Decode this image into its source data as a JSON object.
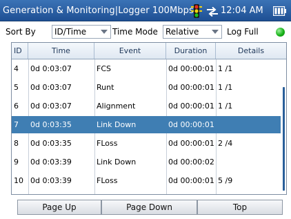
{
  "titlebar": {
    "title": "Generation  &  Monitoring|Logger 100Mbps",
    "time": "12:04 AM",
    "icons": [
      "traffic-light-icon",
      "transfer-arrows-icon",
      "battery-icon"
    ]
  },
  "controls": {
    "sort_by_label": "Sort By",
    "sort_by_value": "ID/Time",
    "time_mode_label": "Time Mode",
    "time_mode_value": "Relative",
    "log_full_label": "Log Full",
    "log_full_status_color": "#19b319"
  },
  "table": {
    "columns": [
      "ID",
      "Time",
      "Event",
      "Duration",
      "Details"
    ],
    "rows": [
      {
        "id": "4",
        "time": "0d 0:03:07",
        "event": "FCS",
        "duration": "0d 00:00:01",
        "details": "1 /1"
      },
      {
        "id": "5",
        "time": "0d 0:03:07",
        "event": "Runt",
        "duration": "0d 00:00:01",
        "details": "1 /1"
      },
      {
        "id": "6",
        "time": "0d 0:03:07",
        "event": "Alignment",
        "duration": "0d 00:00:01",
        "details": "1 /1"
      },
      {
        "id": "7",
        "time": "0d 0:03:35",
        "event": "Link Down",
        "duration": "0d 00:00:01",
        "details": ""
      },
      {
        "id": "8",
        "time": "0d 0:03:35",
        "event": "FLoss",
        "duration": "0d 00:00:01",
        "details": "2 /4"
      },
      {
        "id": "9",
        "time": "0d 0:03:39",
        "event": "Link Down",
        "duration": "0d 00:00:02",
        "details": ""
      },
      {
        "id": "10",
        "time": "0d 0:03:39",
        "event": "FLoss",
        "duration": "0d 00:00:01",
        "details": "5 /9"
      }
    ],
    "selected_row_color": "#3f7eb3"
  },
  "buttons": {
    "page_up": "Page Up",
    "page_down": "Page Down",
    "top": "Top"
  }
}
